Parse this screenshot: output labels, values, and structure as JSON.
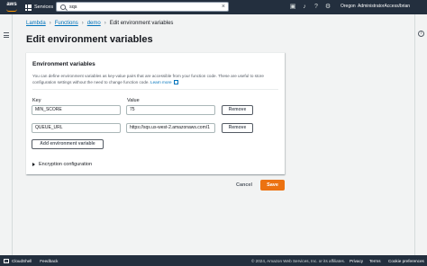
{
  "topnav": {
    "logo_text": "aws",
    "services_label": "Services",
    "search_value": "sqs",
    "region": "Oregon",
    "account": "AdministratorAccess/brian"
  },
  "breadcrumb": {
    "items": [
      "Lambda",
      "Functions",
      "demo"
    ],
    "current": "Edit environment variables"
  },
  "page_title": "Edit environment variables",
  "card": {
    "title": "Environment variables",
    "description": "You can define environment variables as key-value pairs that are accessible from your function code. These are useful to store configuration settings without the need to change function code.",
    "learn_more": "Learn more",
    "key_header": "Key",
    "value_header": "Value",
    "rows": [
      {
        "key": "MIN_SCORE",
        "value": "75",
        "remove": "Remove"
      },
      {
        "key": "QUEUE_URL",
        "value": "https://sqs.us-west-2.amazonaws.com/1",
        "remove": "Remove"
      }
    ],
    "add_button": "Add environment variable",
    "encryption_label": "Encryption configuration"
  },
  "actions": {
    "cancel": "Cancel",
    "save": "Save"
  },
  "footer": {
    "cloudshell": "CloudShell",
    "feedback": "Feedback",
    "copyright": "© 2024, Amazon Web Services, Inc. or its affiliates.",
    "privacy": "Privacy",
    "terms": "Terms",
    "cookie": "Cookie preferences"
  },
  "colors": {
    "nav_bg": "#232f3e",
    "primary_button": "#ec7211",
    "link": "#0073bb",
    "aws_orange": "#ff9900"
  }
}
